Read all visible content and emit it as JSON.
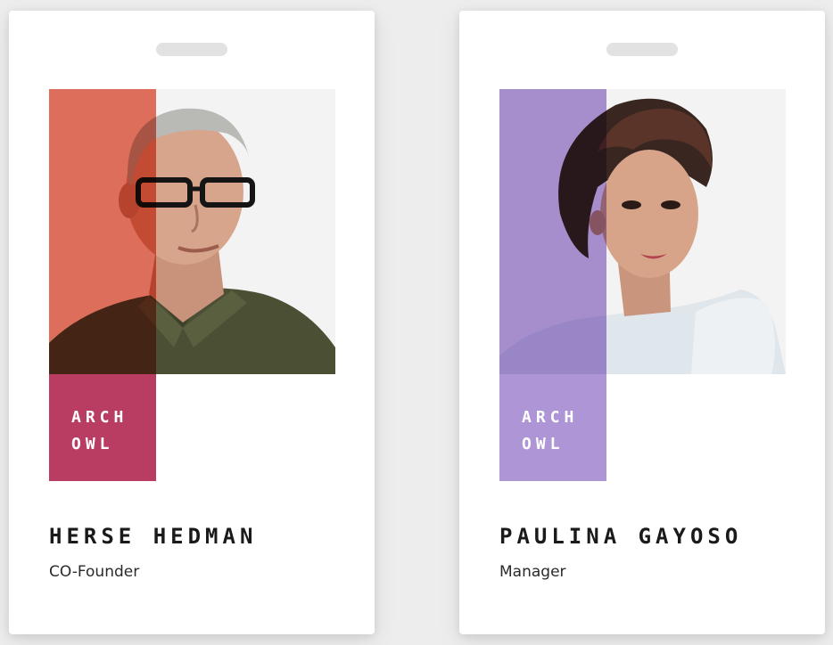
{
  "cards": [
    {
      "brand_line1": "ARCH",
      "brand_line2": "OWL",
      "name": "HERSE HEDMAN",
      "role": "CO-Founder",
      "accent_color": "#e8735f",
      "bar_color_bottom": "#b93d63",
      "portrait_icon": "man-with-glasses-portrait"
    },
    {
      "brand_line1": "ARCH",
      "brand_line2": "OWL",
      "name": "PAULINA GAYOSO",
      "role": "Manager",
      "accent_color": "#ae95d6",
      "bar_color_bottom": "#ae95d6",
      "portrait_icon": "woman-portrait"
    }
  ]
}
